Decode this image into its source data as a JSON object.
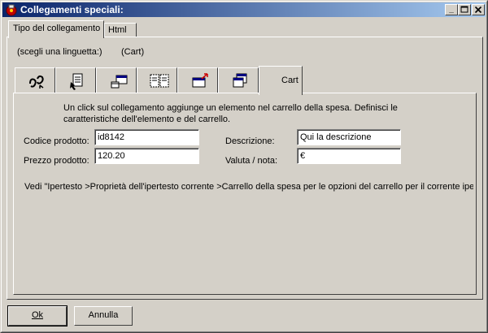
{
  "window": {
    "title": "Collegamenti speciali:"
  },
  "outer_tabs": [
    {
      "label": "Tipo del collegamento"
    },
    {
      "label": "Html"
    }
  ],
  "hint": {
    "text": "(scegli una linguetta:)",
    "current": "(Cart)"
  },
  "icon_tabs": [
    {
      "icon": "link-chain-icon"
    },
    {
      "icon": "document-pointer-icon"
    },
    {
      "icon": "window-icon"
    },
    {
      "icon": "frames-icon"
    },
    {
      "icon": "window-arrow-icon"
    },
    {
      "icon": "stacked-windows-icon"
    },
    {
      "label": "Cart"
    }
  ],
  "cart": {
    "description_lines": [
      "Un click sul collegamento aggiunge un elemento nel carrello della spesa. Definisci le",
      "caratteristiche dell'elemento e del carrello."
    ],
    "product_code_label": "Codice prodotto:",
    "product_code_value": "id8142",
    "price_label": "Prezzo prodotto:",
    "price_value": "120.20",
    "description_label": "Descrizione:",
    "description_value": "Qui la descrizione",
    "currency_label": "Valuta / nota:",
    "currency_value": "€",
    "footer_note": "Vedi \"Ipertesto >Proprietà dell'ipertesto corrente >Carrello della spesa per le opzioni del carrello per il corrente ipertesto\""
  },
  "buttons": {
    "ok": "Ok",
    "cancel": "Annulla"
  }
}
